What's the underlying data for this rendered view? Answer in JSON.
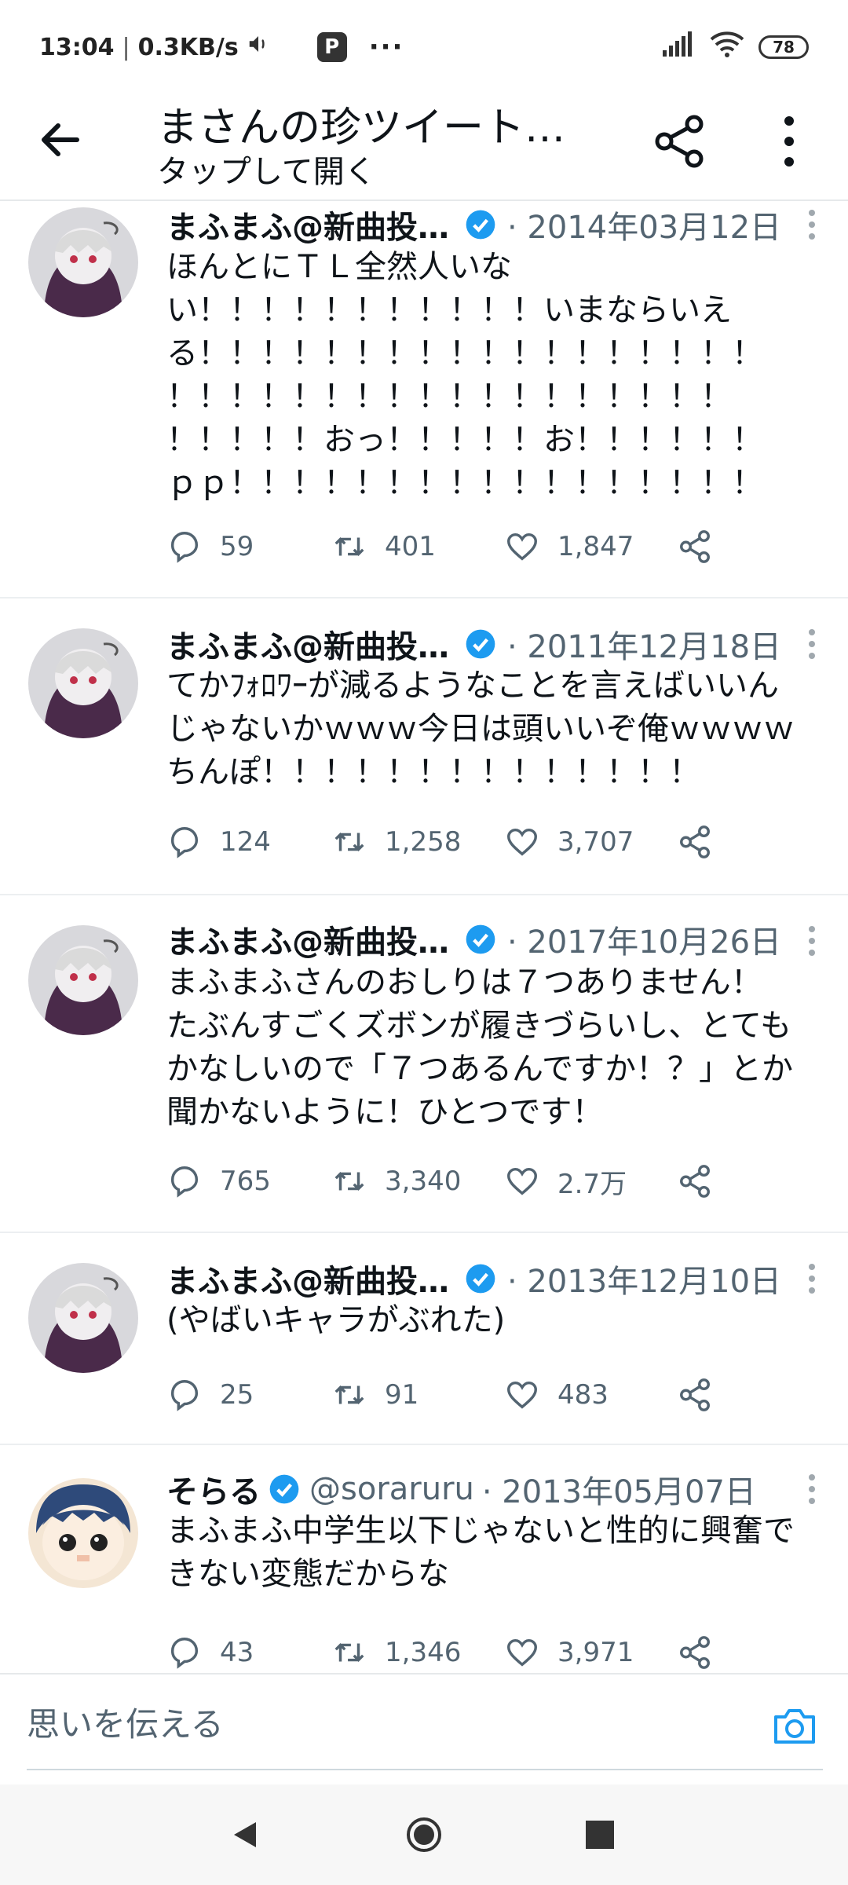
{
  "status_bar": {
    "time": "13:04",
    "speed": "0.3KB/s",
    "battery": "78"
  },
  "header": {
    "title": "まさんの珍ツイート…",
    "subtitle": "タップして開く"
  },
  "tweets": [
    {
      "name": "まふまふ@新曲投…",
      "handle": "",
      "date": "· 2014年03月12日",
      "text": "ほんとにＴＬ全然人いな\nい！！！！！！！！！！！いまならいえ\nる！！！！！！！！！！！！！！！！！！\n！！！！！！！！！！！！！！！！！！\n！！！！！おっ！！！！！お！！！！！！\nｐｐ！！！！！！！！！！！！！！！！！",
      "replies": "59",
      "retweets": "401",
      "likes": "1,847"
    },
    {
      "name": "まふまふ@新曲投…",
      "handle": "",
      "date": "· 2011年12月18日",
      "text": "てかﾌｫﾛﾜｰが減るようなことを言えばいいん\nじゃないかｗｗｗ今日は頭いいぞ俺ｗｗｗｗ\nちんぽ！！！！！！！！！！！！！！",
      "replies": "124",
      "retweets": "1,258",
      "likes": "3,707"
    },
    {
      "name": "まふまふ@新曲投…",
      "handle": "",
      "date": "· 2017年10月26日",
      "text": "まふまふさんのおしりは７つありません！\nたぶんすごくズボンが履きづらいし、とても\nかなしいので「７つあるんですか！？」とか\n聞かないように！ひとつです！",
      "replies": "765",
      "retweets": "3,340",
      "likes": "2.7万"
    },
    {
      "name": "まふまふ@新曲投…",
      "handle": "",
      "date": "· 2013年12月10日",
      "text": "(やばいキャラがぶれた)",
      "replies": "25",
      "retweets": "91",
      "likes": "483"
    },
    {
      "name": "そらる",
      "handle": "@soraruru",
      "date": "· 2013年05月07日",
      "text": "まふまふ中学生以下じゃないと性的に興奮で\nきない変態だからな",
      "replies": "43",
      "retweets": "1,346",
      "likes": "3,971"
    }
  ],
  "reply_bar": {
    "placeholder": "思いを伝える"
  },
  "colors": {
    "verified": "#1d9bf0",
    "muted": "#536471",
    "accent": "#1d9bf0"
  }
}
